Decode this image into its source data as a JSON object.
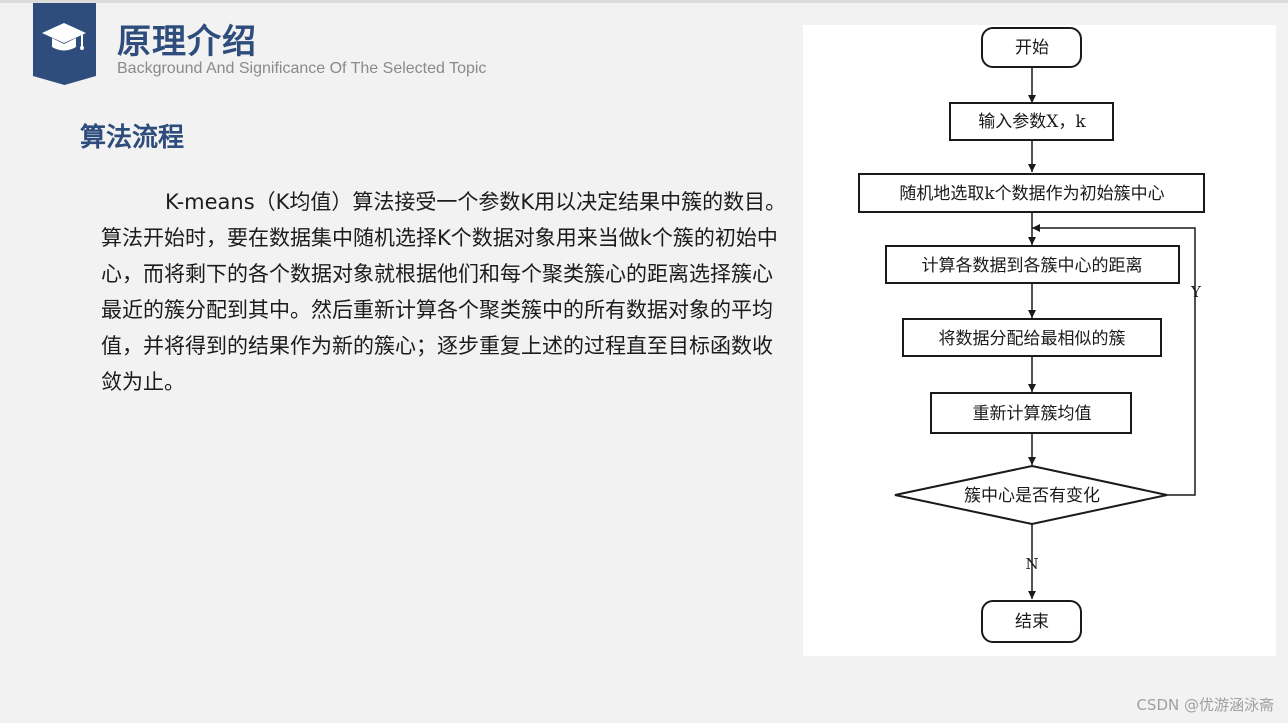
{
  "header": {
    "title": "原理介绍",
    "subtitle": "Background And Significance Of The Selected Topic",
    "icon": "graduation-cap-icon"
  },
  "section": {
    "heading": "算法流程",
    "paragraph": "K-means（K均值）算法接受一个参数K用以决定结果中簇的数目。算法开始时，要在数据集中随机选择K个数据对象用来当做k个簇的初始中心，而将剩下的各个数据对象就根据他们和每个聚类簇心的距离选择簇心最近的簇分配到其中。然后重新计算各个聚类簇中的所有数据对象的平均值，并将得到的结果作为新的簇心；逐步重复上述的过程直至目标函数收敛为止。"
  },
  "flowchart": {
    "start": "开始",
    "input": "输入参数X，k",
    "init": "随机地选取k个数据作为初始簇中心",
    "distance": "计算各数据到各簇中心的距离",
    "assign": "将数据分配给最相似的簇",
    "recompute": "重新计算簇均值",
    "decision": "簇中心是否有变化",
    "yes_label": "Y",
    "no_label": "N",
    "end": "结束"
  },
  "watermark": "CSDN @优游涵泳斋",
  "colors": {
    "accent": "#2e4d7d",
    "background": "#f2f2f2"
  }
}
